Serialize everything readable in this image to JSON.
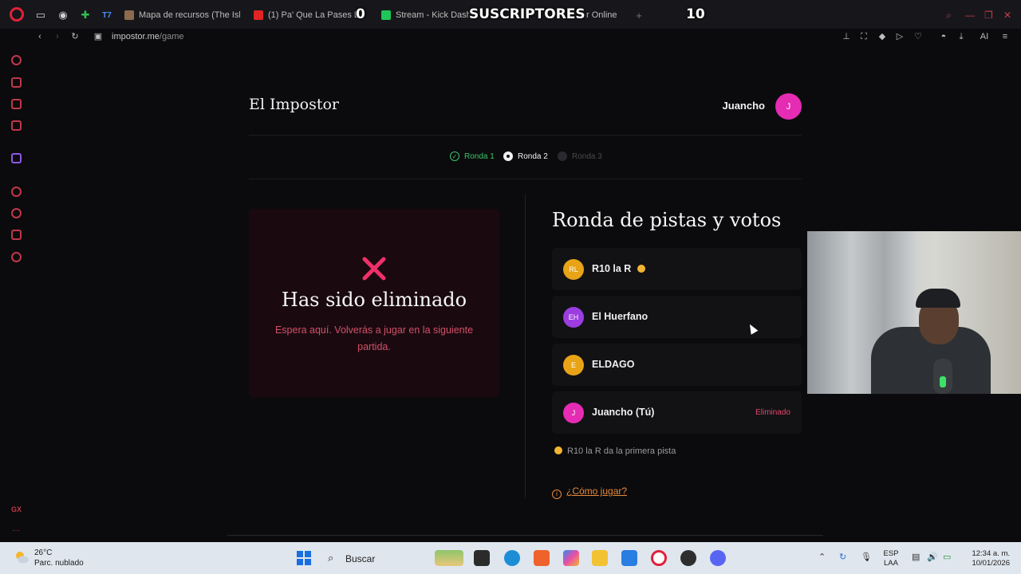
{
  "browser": {
    "tabs": [
      {
        "label": "Mapa de recursos (The Isl"
      },
      {
        "label": "(1) Pa' Que La Pases Bie"
      },
      {
        "label": "Stream - Kick Dashb"
      },
      {
        "label": "r Online"
      }
    ],
    "overlay_left_count": "0",
    "overlay_title": "SUSCRIPTORES",
    "overlay_right_count": "10",
    "address_host": "impostor.me",
    "address_path": "/game",
    "toolbar_ai": "AI"
  },
  "app": {
    "title": "El Impostor",
    "username": "Juancho",
    "user_initial": "J"
  },
  "rounds": [
    {
      "label": "Ronda 1",
      "state": "done"
    },
    {
      "label": "Ronda 2",
      "state": "current"
    },
    {
      "label": "Ronda 3",
      "state": "pending"
    }
  ],
  "eliminated": {
    "title": "Has sido eliminado",
    "message": "Espera aquí. Volverás a jugar en la siguiente partida."
  },
  "clue_section": {
    "title": "Ronda de pistas y votos",
    "players": [
      {
        "initials": "RL",
        "name": "R10 la R",
        "color": "#e8a317",
        "status": ""
      },
      {
        "initials": "EH",
        "name": "El Huerfano",
        "color": "#9b3de0",
        "status": ""
      },
      {
        "initials": "E",
        "name": "ELDAGO",
        "color": "#e8a317",
        "status": ""
      },
      {
        "initials": "J",
        "name": "Juancho (Tú)",
        "color": "#e52cb3",
        "status": "Eliminado"
      }
    ],
    "hint": "R10 la R da la primera pista",
    "how_to_play": "¿Cómo jugar?"
  },
  "taskbar": {
    "temperature": "26°C",
    "weather": "Parc. nublado",
    "search_placeholder": "Buscar",
    "lang_1": "ESP",
    "lang_2": "LAA",
    "time": "12:34 a. m.",
    "date": "10/01/2026"
  },
  "colors": {
    "accent": "#e52cb3",
    "danger": "#e0486a",
    "success": "#3cc46a",
    "link": "#e88a3a"
  }
}
